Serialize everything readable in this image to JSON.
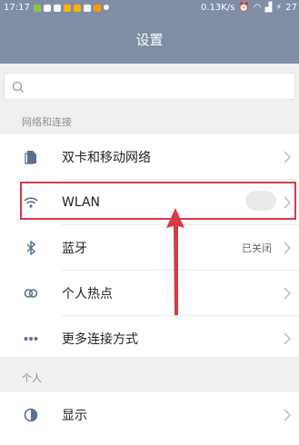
{
  "status_bar": {
    "time": "17:17",
    "network_speed": "0.13K/s",
    "battery": "27"
  },
  "header": {
    "title": "设置"
  },
  "search": {
    "placeholder": ""
  },
  "sections": [
    {
      "label": "网络和连接",
      "items": [
        {
          "label": "双卡和移动网络",
          "value": "",
          "icon": "sim-card-icon"
        },
        {
          "label": "WLAN",
          "value": "",
          "icon": "wifi-icon"
        },
        {
          "label": "蓝牙",
          "value": "已关闭",
          "icon": "bluetooth-icon"
        },
        {
          "label": "个人热点",
          "value": "",
          "icon": "hotspot-icon"
        },
        {
          "label": "更多连接方式",
          "value": "",
          "icon": "more-dots-icon"
        }
      ]
    },
    {
      "label": "个人",
      "items": [
        {
          "label": "显示",
          "value": "",
          "icon": "display-icon"
        }
      ]
    }
  ],
  "colors": {
    "header": "#7f8ea5",
    "highlight": "#d63a47",
    "arrow": "#d63a47"
  }
}
